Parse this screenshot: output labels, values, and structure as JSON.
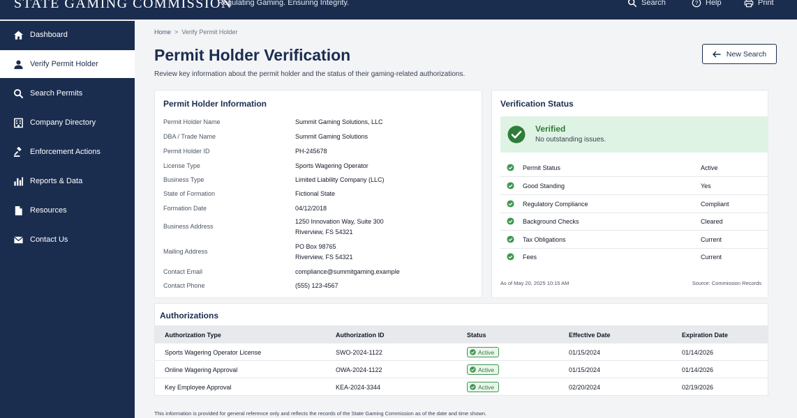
{
  "header": {
    "brand": "STATE GAMING COMMISSION",
    "tagline": "Regulating Gaming. Ensuring Integrity.",
    "search_label": "Search",
    "help_label": "Help",
    "print_label": "Print"
  },
  "sidebar": {
    "items": [
      {
        "label": "Dashboard",
        "icon": "home-icon"
      },
      {
        "label": "Verify Permit Holder",
        "icon": "user-icon",
        "active": true
      },
      {
        "label": "Search Permits",
        "icon": "search-icon"
      },
      {
        "label": "Company Directory",
        "icon": "building-icon"
      },
      {
        "label": "Enforcement Actions",
        "icon": "gavel-icon"
      },
      {
        "label": "Reports & Data",
        "icon": "bar-chart-icon"
      },
      {
        "label": "Resources",
        "icon": "document-icon"
      },
      {
        "label": "Contact Us",
        "icon": "envelope-icon"
      }
    ]
  },
  "breadcrumb": {
    "home": "Home",
    "separator": ">",
    "current": "Verify Permit Holder"
  },
  "page": {
    "title": "Permit Holder Verification",
    "description": "Review key information about the permit holder and the status of their gaming-related authorizations.",
    "new_search_label": "New Search"
  },
  "holder_info": {
    "title": "Permit Holder Information",
    "rows": [
      {
        "label": "Permit Holder Name",
        "value": "Summit Gaming Solutions, LLC"
      },
      {
        "label": "DBA / Trade Name",
        "value": "Summit Gaming Solutions"
      },
      {
        "label": "Permit Holder ID",
        "value": "PH-245678"
      },
      {
        "label": "License Type",
        "value": "Sports Wagering Operator"
      },
      {
        "label": "Business Type",
        "value": "Limited Liability Company (LLC)"
      },
      {
        "label": "State of Formation",
        "value": "Fictional State"
      },
      {
        "label": "Formation Date",
        "value": "04/12/2018"
      },
      {
        "label": "Business Address",
        "value_line1": "1250 Innovation Way, Suite 300",
        "value_line2": "Riverview, FS 54321"
      },
      {
        "label": "Mailing Address",
        "value_line1": "PO Box 98765",
        "value_line2": "Riverview, FS 54321"
      },
      {
        "label": "Contact Email",
        "value": "compliance@summitgaming.example"
      },
      {
        "label": "Contact Phone",
        "value": "(555) 123-4567"
      }
    ]
  },
  "verification": {
    "title": "Verification Status",
    "status": "Verified",
    "status_sub": "No outstanding issues.",
    "checks": [
      {
        "label": "Permit Status",
        "value": "Active"
      },
      {
        "label": "Good Standing",
        "value": "Yes"
      },
      {
        "label": "Regulatory Compliance",
        "value": "Compliant"
      },
      {
        "label": "Background Checks",
        "value": "Cleared"
      },
      {
        "label": "Tax Obligations",
        "value": "Current"
      },
      {
        "label": "Fees",
        "value": "Current"
      }
    ],
    "as_of": "As of May 20, 2025 10:15 AM",
    "source": "Source: Commission Records"
  },
  "authorizations": {
    "title": "Authorizations",
    "columns": [
      "Authorization Type",
      "Authorization ID",
      "Status",
      "Effective Date",
      "Expiration Date"
    ],
    "rows": [
      {
        "type": "Sports Wagering Operator License",
        "id": "SWO-2024-1122",
        "status": "Active",
        "effective": "01/15/2024",
        "expiration": "01/14/2026"
      },
      {
        "type": "Online Wagering Approval",
        "id": "OWA-2024-1122",
        "status": "Active",
        "effective": "01/15/2024",
        "expiration": "01/14/2026"
      },
      {
        "type": "Key Employee Approval",
        "id": "KEA-2024-3344",
        "status": "Active",
        "effective": "02/20/2024",
        "expiration": "02/19/2026"
      }
    ]
  },
  "footnote": "This information is provided for general reference only and reflects the records of the State Gaming Commission as of the date and time shown.",
  "colors": {
    "navy": "#1b2d4f",
    "success_green": "#2e7d3a",
    "success_bg": "#dff3e4",
    "page_bg": "#f3f4f6"
  }
}
